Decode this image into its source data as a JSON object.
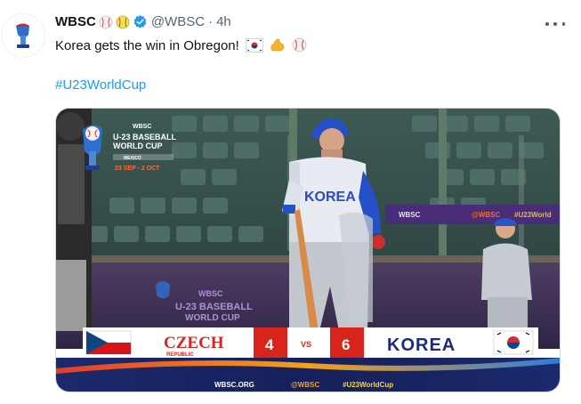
{
  "tweet": {
    "display_name": "WBSC",
    "handle": "@WBSC",
    "separator": "·",
    "time": "4h",
    "text": "Korea gets the win in Obregon!",
    "hashtag": "#U23WorldCup",
    "name_emoji": [
      "baseball-icon",
      "softball-icon"
    ],
    "text_emoji": [
      "korea-flag-icon",
      "flexed-biceps-icon",
      "baseball-icon"
    ]
  },
  "media": {
    "event_brand": "WBSC",
    "event_title_line1": "U-23 BASEBALL",
    "event_title_line2": "WORLD CUP",
    "event_host": "MEXICO",
    "event_dates": "23 SEP - 2 OCT",
    "jersey_text": "KOREA",
    "wall_logo_brand": "WBSC",
    "wall_logo_line1": "U-23 BASEBALL",
    "wall_logo_line2": "WORLD CUP",
    "banner_text": "WBSC.ORG  @WBSC  #U23WorldCup",
    "scoreboard": {
      "team1": "CZECH",
      "team1_sub": "REPUBLIC",
      "score1": "4",
      "vs": "VS",
      "score2": "6",
      "team2": "KOREA"
    },
    "footer": {
      "site": "WBSC.ORG",
      "handle": "@WBSC",
      "tag": "#U23WorldCup"
    }
  },
  "colors": {
    "link": "#1d9bf0",
    "verified": "#1d9bf0",
    "scoreboard_red": "#d9241c",
    "footer_navy": "#16205a"
  }
}
